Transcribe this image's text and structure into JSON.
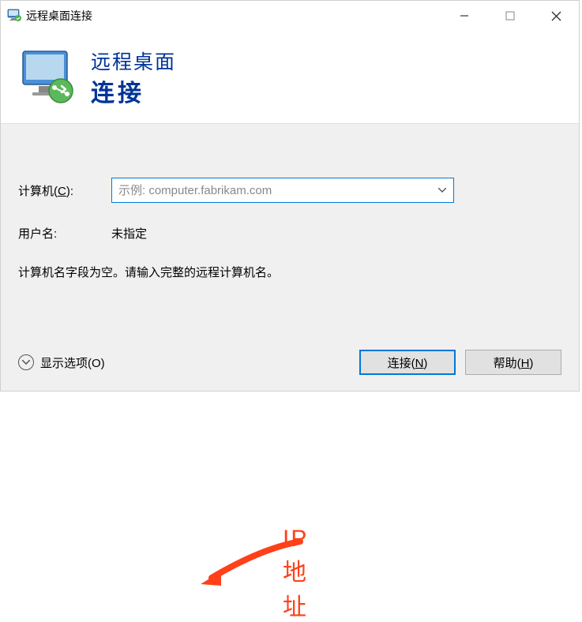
{
  "titlebar": {
    "title": "远程桌面连接"
  },
  "header": {
    "line1": "远程桌面",
    "line2": "连接"
  },
  "form": {
    "computer_label_text": "计算机(",
    "computer_label_key": "C",
    "computer_label_suffix": "):",
    "computer_placeholder": "示例: computer.fabrikam.com",
    "username_label": "用户名:",
    "username_value": "未指定",
    "hint": "计算机名字段为空。请输入完整的远程计算机名。"
  },
  "footer": {
    "options_text": "显示选项(",
    "options_key": "O",
    "options_suffix": ")",
    "connect_text": "连接(",
    "connect_key": "N",
    "connect_suffix": ")",
    "help_text": "帮助(",
    "help_key": "H",
    "help_suffix": ")"
  },
  "annotation": {
    "label": "IP地址"
  }
}
